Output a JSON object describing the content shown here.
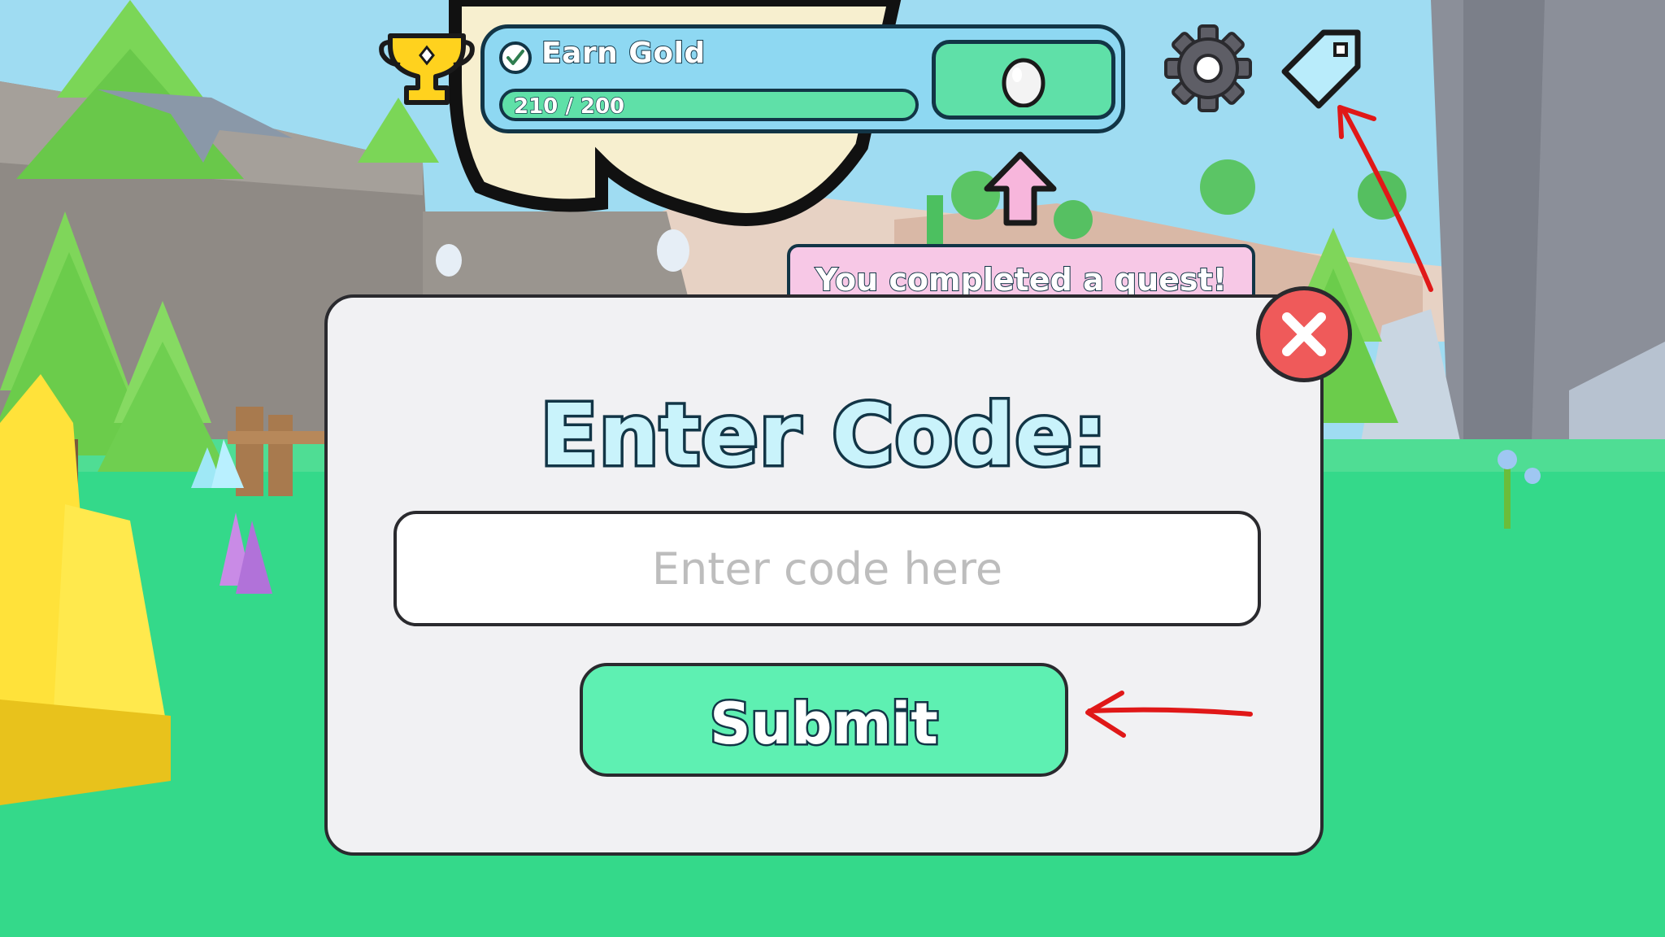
{
  "quest": {
    "title": "Earn Gold",
    "progress_text": "210 / 200",
    "progress_fraction": 1.0
  },
  "toast": {
    "message": "You completed a quest!"
  },
  "dialog": {
    "title": "Enter Code:",
    "input_placeholder": "Enter code here",
    "input_value": "",
    "submit_label": "Submit"
  },
  "icons": {
    "trophy": "trophy-icon",
    "settings": "gear-icon",
    "codes": "tag-icon",
    "close": "close-icon",
    "quest_complete": "check-icon",
    "reward": "egg-icon",
    "up_arrow": "arrow-up-icon"
  },
  "colors": {
    "quest_bg": "#8ed8f2",
    "progress_fill": "#5fe0a8",
    "dialog_bg": "#f1f1f3",
    "submit_bg": "#5ef0b2",
    "close_bg": "#ef5a5a",
    "toast_bg": "#f7c8e6",
    "annotation_arrow": "#e01818"
  }
}
